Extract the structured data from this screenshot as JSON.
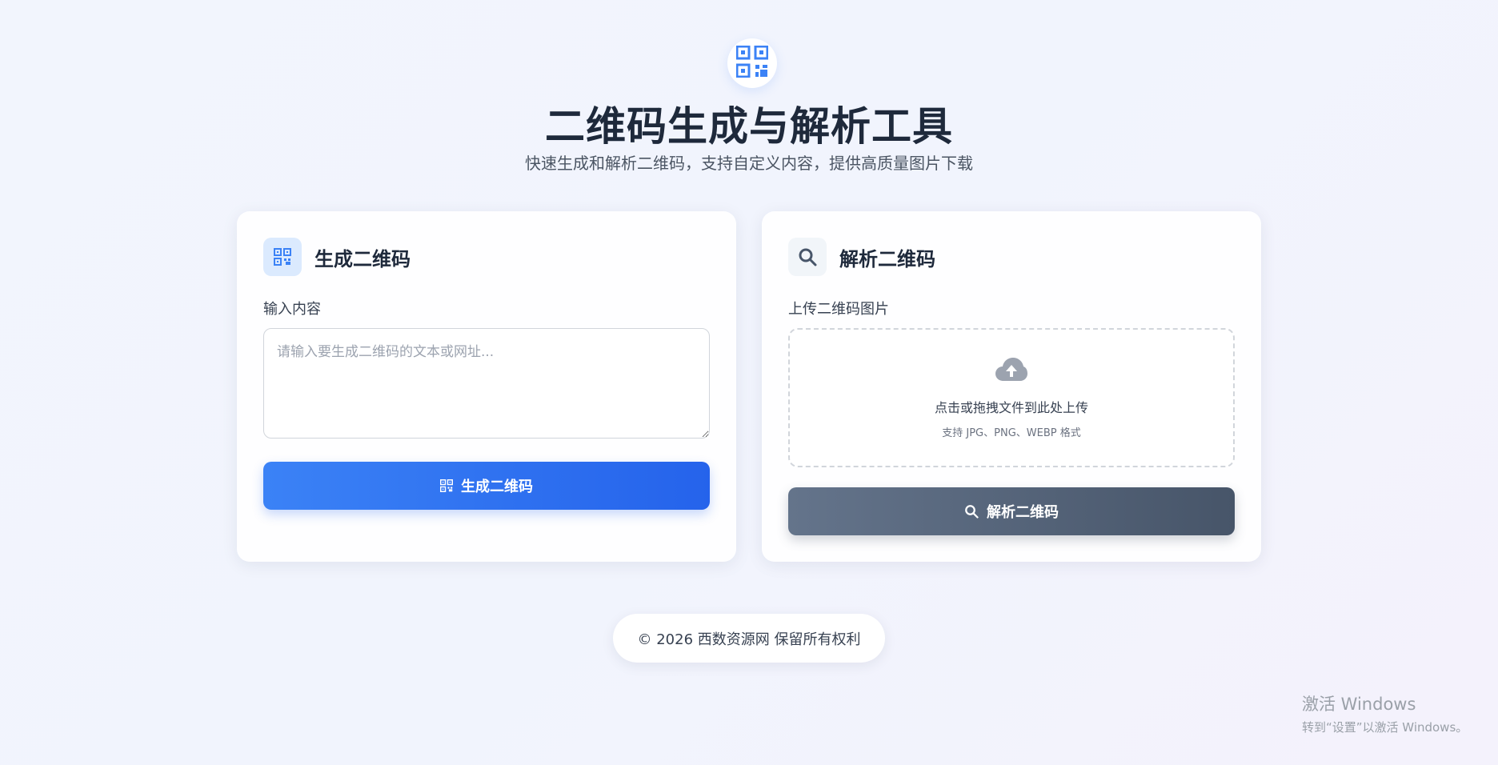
{
  "header": {
    "logo_icon": "qr-code-icon",
    "title": "二维码生成与解析工具",
    "subtitle": "快速生成和解析二维码，支持自定义内容，提供高质量图片下载"
  },
  "generate": {
    "icon": "qr-code-icon",
    "title": "生成二维码",
    "input_label": "输入内容",
    "input_value": "",
    "input_placeholder": "请输入要生成二维码的文本或网址...",
    "button_label": "生成二维码",
    "button_icon": "qr-code-icon"
  },
  "parse": {
    "icon": "search-icon",
    "title": "解析二维码",
    "upload_label": "上传二维码图片",
    "upload_icon": "cloud-upload-icon",
    "upload_text": "点击或拖拽文件到此处上传",
    "upload_hint": "支持 JPG、PNG、WEBP 格式",
    "button_label": "解析二维码",
    "button_icon": "search-icon"
  },
  "footer": {
    "copyright": "© 2026 西数资源网 保留所有权利"
  },
  "watermark": {
    "title": "激活 Windows",
    "subtitle": "转到“设置”以激活 Windows。"
  },
  "colors": {
    "primary": "#3b82f6",
    "primary_dark": "#2563eb",
    "slate": "#64748b",
    "slate_dark": "#475569",
    "text": "#1e293b"
  }
}
